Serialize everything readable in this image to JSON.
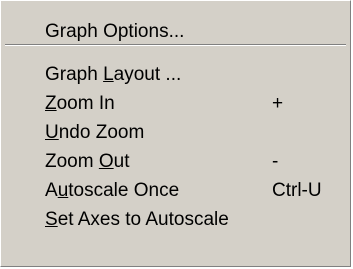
{
  "menu": {
    "items": [
      {
        "pre": "Graph Options...",
        "mn": "",
        "post": "",
        "shortcut": ""
      },
      {
        "pre": "Graph ",
        "mn": "L",
        "post": "ayout ...",
        "shortcut": ""
      },
      {
        "pre": "",
        "mn": "Z",
        "post": "oom In",
        "shortcut": "+"
      },
      {
        "pre": "",
        "mn": "U",
        "post": "ndo Zoom",
        "shortcut": ""
      },
      {
        "pre": "Zoom ",
        "mn": "O",
        "post": "ut",
        "shortcut": "-"
      },
      {
        "pre": "A",
        "mn": "u",
        "post": "toscale Once",
        "shortcut": "Ctrl-U"
      },
      {
        "pre": "",
        "mn": "S",
        "post": "et Axes to Autoscale",
        "shortcut": ""
      }
    ]
  }
}
